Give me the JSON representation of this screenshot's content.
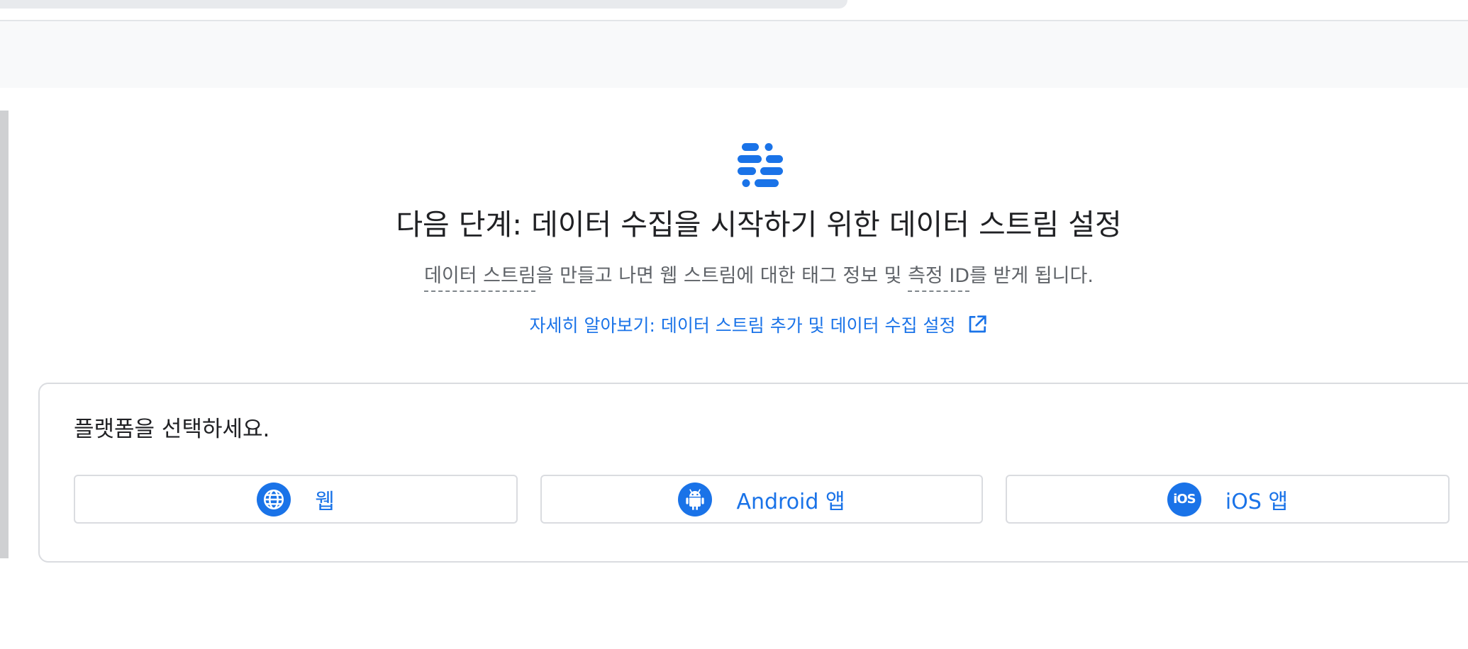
{
  "setup": {
    "heading": "다음 단계: 데이터 수집을 시작하기 위한 데이터 스트림 설정",
    "description": {
      "term1": "데이터 스트림",
      "part1": "을 만들고 나면 웹 스트림에 대한 태그 정보 및 ",
      "term2": "측정 ID",
      "part2": "를 받게 됩니다."
    },
    "learn_more_link": "자세히 알아보기: 데이터 스트림 추가 및 데이터 수집 설정"
  },
  "platform_picker": {
    "title": "플랫폼을 선택하세요.",
    "options": [
      {
        "label": "웹",
        "icon": "globe-icon"
      },
      {
        "label": "Android 앱",
        "icon": "android-icon"
      },
      {
        "label": "iOS 앱",
        "icon": "ios-icon"
      }
    ]
  },
  "colors": {
    "accent": "#1a73e8",
    "heading_text": "#202124",
    "body_text": "#5f6368",
    "border": "#dadce0",
    "header_band": "#f8f9fa"
  }
}
